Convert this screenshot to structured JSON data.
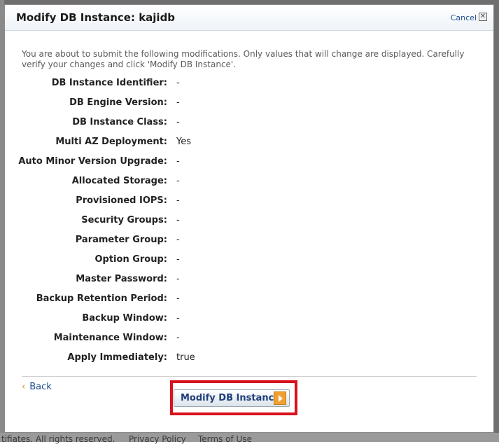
{
  "dialog": {
    "title": "Modify DB Instance: kajidb",
    "cancel_label": "Cancel",
    "close_glyph": "✕",
    "intro": "You are about to submit the following modifications. Only values that will change are displayed. Carefully verify your changes and click 'Modify DB Instance'.",
    "fields": [
      {
        "label": "DB Instance Identifier:",
        "value": "-"
      },
      {
        "label": "DB Engine Version:",
        "value": "-"
      },
      {
        "label": "DB Instance Class:",
        "value": "-"
      },
      {
        "label": "Multi AZ Deployment:",
        "value": "Yes"
      },
      {
        "label": "Auto Minor Version Upgrade:",
        "value": "-"
      },
      {
        "label": "Allocated Storage:",
        "value": "-"
      },
      {
        "label": "Provisioned IOPS:",
        "value": "-"
      },
      {
        "label": "Security Groups:",
        "value": "-"
      },
      {
        "label": "Parameter Group:",
        "value": "-"
      },
      {
        "label": "Option Group:",
        "value": "-"
      },
      {
        "label": "Master Password:",
        "value": "-"
      },
      {
        "label": "Backup Retention Period:",
        "value": "-"
      },
      {
        "label": "Backup Window:",
        "value": "-"
      },
      {
        "label": "Maintenance Window:",
        "value": "-"
      },
      {
        "label": "Apply Immediately:",
        "value": "true"
      }
    ],
    "back_chevron": "‹",
    "back_label": "Back",
    "submit_label": "Modify DB Instance",
    "submit_icon": "arrow-right-icon",
    "highlight_color": "#d8111c"
  },
  "footer": {
    "copyright": "tifiates. All rights reserved.",
    "privacy": "Privacy Policy",
    "terms": "Terms of Use"
  }
}
